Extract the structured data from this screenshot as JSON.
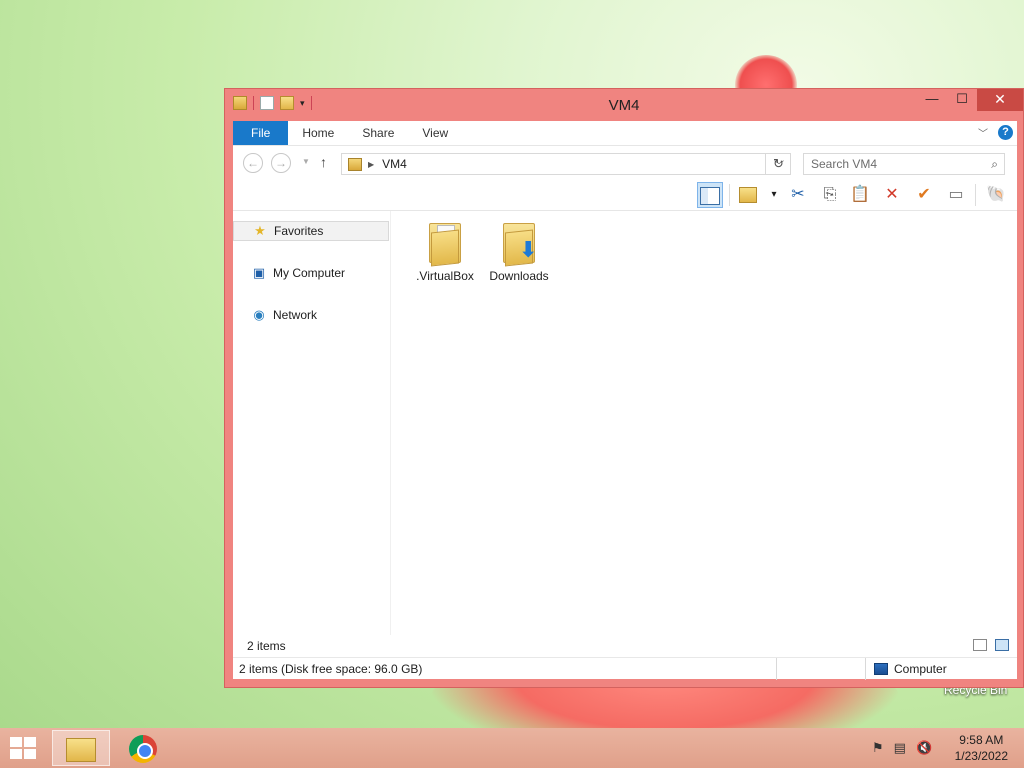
{
  "desktop": {
    "recycle_bin_label": "Recycle Bin"
  },
  "window": {
    "title": "VM4",
    "controls": {
      "minimize": "—",
      "maximize": "☐",
      "close": "✕"
    },
    "ribbon": {
      "tabs": [
        "File",
        "Home",
        "Share",
        "View"
      ]
    },
    "address": {
      "back": "←",
      "forward": "→",
      "up": "↑",
      "path": "VM4",
      "search_placeholder": "Search VM4"
    },
    "nav_pane": {
      "items": [
        "Favorites",
        "My Computer",
        "Network"
      ]
    },
    "content": {
      "items": [
        {
          "name": ".VirtualBox",
          "icon": "folder-icon"
        },
        {
          "name": "Downloads",
          "icon": "downloads-folder-icon"
        }
      ]
    },
    "items_bar": {
      "count": "2 items"
    },
    "status_bar": {
      "left": "2 items (Disk free space: 96.0 GB)",
      "right": "Computer"
    }
  },
  "taskbar": {
    "time": "9:58 AM",
    "date": "1/23/2022"
  }
}
